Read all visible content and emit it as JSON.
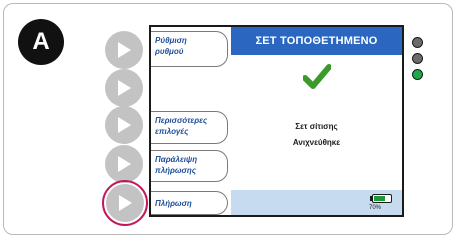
{
  "step": {
    "label": "A"
  },
  "menu": {
    "items": [
      {
        "line1": "Ρύθμιση",
        "line2": "ρυθμού"
      },
      {
        "line1": "Περισσότερες",
        "line2": "επιλογές"
      },
      {
        "line1": "Παράλειψη",
        "line2": "πλήρωσης"
      },
      {
        "line1": "Πλήρωση"
      }
    ]
  },
  "screen": {
    "header": "ΣΕΤ ΤΟΠΟΘΕΤΗΜΕΝΟ",
    "message_line1": "Σετ σίτισης",
    "message_line2": "Ανιχνεύθηκε",
    "battery_percent": "70%",
    "battery_level": 0.7,
    "check_icon": "check-icon",
    "check_color": "#3b9a2a",
    "header_color": "#2b67c1"
  },
  "indicators": {
    "colors": [
      "#6b6b6b",
      "#6b6b6b",
      "#1faa4a"
    ]
  },
  "highlight_color": "#c2185b"
}
